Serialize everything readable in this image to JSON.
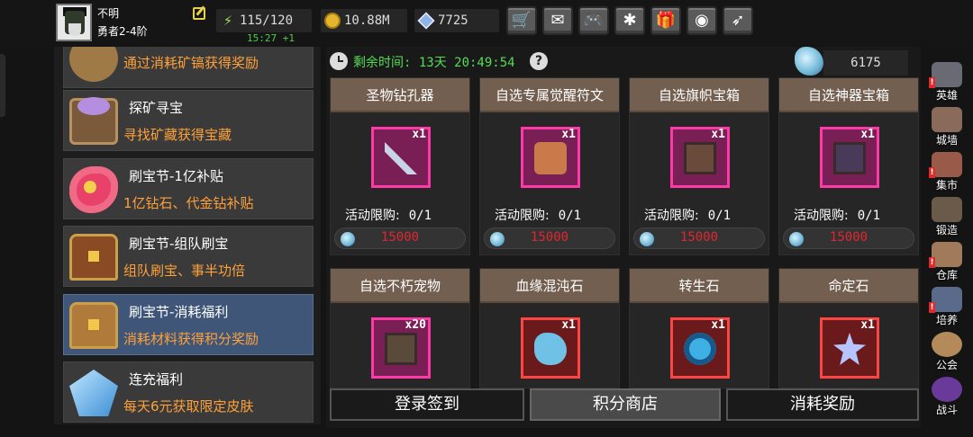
{
  "player": {
    "name": "不明",
    "level": "勇者2-4阶"
  },
  "resources": {
    "energy": "115/120",
    "energy_timer": "15:27 +1",
    "gold": "10.88M",
    "gems": "7725"
  },
  "toolbar": [
    {
      "name": "shop",
      "glyph": "🛒"
    },
    {
      "name": "mail",
      "glyph": "✉"
    },
    {
      "name": "gamepad",
      "glyph": "🎮"
    },
    {
      "name": "settings",
      "glyph": "✱"
    },
    {
      "name": "gift",
      "glyph": "🎁"
    },
    {
      "name": "color-wheel",
      "glyph": "◉"
    },
    {
      "name": "feather",
      "glyph": "➶"
    }
  ],
  "left_list": [
    {
      "title": "",
      "subtitle": "通过消耗矿镐获得奖励",
      "icon": "chest-icon"
    },
    {
      "title": "探矿寻宝",
      "subtitle": "寻找矿藏获得宝藏",
      "icon": "treasure-chest-icon"
    },
    {
      "title": "刷宝节-1亿补贴",
      "subtitle": "1亿钻石、代金钻补贴",
      "icon": "flower-icon"
    },
    {
      "title": "刷宝节-组队刷宝",
      "subtitle": "组队刷宝、事半功倍",
      "icon": "red-chest-icon"
    },
    {
      "title": "刷宝节-消耗福利",
      "subtitle": "消耗材料获得积分奖励",
      "icon": "open-chest-icon"
    },
    {
      "title": "连充福利",
      "subtitle": "每天6元获取限定皮肤",
      "icon": "crystal-icon"
    }
  ],
  "event": {
    "remaining_label": "剩余时间: 13天 20:49:54",
    "points": "6175"
  },
  "shop_items": [
    {
      "name": "圣物钻孔器",
      "qty": "x1",
      "limit_label": "活动限购:",
      "limit": "0/1",
      "price": "15000",
      "icon": "drill-icon"
    },
    {
      "name": "自选专属觉醒符文",
      "qty": "x1",
      "limit_label": "活动限购:",
      "limit": "0/1",
      "price": "15000",
      "icon": "rune-scroll-icon"
    },
    {
      "name": "自选旗帜宝箱",
      "qty": "x1",
      "limit_label": "活动限购:",
      "limit": "0/1",
      "price": "15000",
      "icon": "flag-chest-icon"
    },
    {
      "name": "自选神器宝箱",
      "qty": "x1",
      "limit_label": "活动限购:",
      "limit": "0/1",
      "price": "15000",
      "icon": "artifact-chest-icon"
    },
    {
      "name": "自选不朽宠物",
      "qty": "x20",
      "icon": "pet-chest-icon"
    },
    {
      "name": "血缘混沌石",
      "qty": "x1",
      "icon": "chaos-stone-icon"
    },
    {
      "name": "转生石",
      "qty": "x1",
      "icon": "rebirth-stone-icon"
    },
    {
      "name": "命定石",
      "qty": "x1",
      "icon": "fate-stone-icon"
    }
  ],
  "bottom_tabs": [
    {
      "label": "登录签到",
      "active": false
    },
    {
      "label": "积分商店",
      "active": true
    },
    {
      "label": "消耗奖励",
      "active": false
    }
  ],
  "sidebar": [
    {
      "label": "英雄",
      "icon": "helmet-icon",
      "alert": true
    },
    {
      "label": "城墙",
      "icon": "wall-icon",
      "alert": false
    },
    {
      "label": "集市",
      "icon": "market-icon",
      "alert": true
    },
    {
      "label": "锻造",
      "icon": "anvil-icon",
      "alert": false
    },
    {
      "label": "仓库",
      "icon": "warehouse-icon",
      "alert": true
    },
    {
      "label": "培养",
      "icon": "trophy-icon",
      "alert": true
    },
    {
      "label": "公会",
      "icon": "guild-icon",
      "alert": false
    },
    {
      "label": "战斗",
      "icon": "portal-icon",
      "alert": false
    }
  ]
}
